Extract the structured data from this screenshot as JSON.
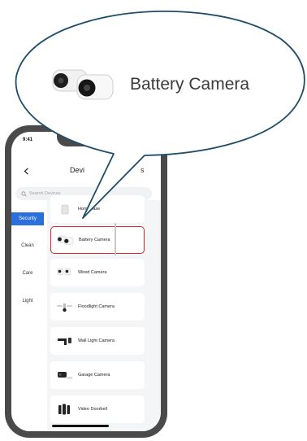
{
  "status_bar": {
    "time": "9:41"
  },
  "nav": {
    "title": "Devi",
    "right_text": "s"
  },
  "search": {
    "placeholder": "Search Devices"
  },
  "sidebar": {
    "items": [
      {
        "label": "Security",
        "active": true
      },
      {
        "label": "Clean",
        "active": false
      },
      {
        "label": "Care",
        "active": false
      },
      {
        "label": "Light",
        "active": false
      }
    ]
  },
  "devices": [
    {
      "label": "HomeBase",
      "icon": "homebase-icon"
    },
    {
      "label": "Battery Camera",
      "icon": "battery-camera-icon",
      "selected": true
    },
    {
      "label": "Wired Camera",
      "icon": "wired-camera-icon"
    },
    {
      "label": "Floodlight Camera",
      "icon": "floodlight-camera-icon"
    },
    {
      "label": "Wall Light Camera",
      "icon": "wall-light-camera-icon"
    },
    {
      "label": "Garage Camera",
      "icon": "garage-camera-icon"
    },
    {
      "label": "Video Doorbell",
      "icon": "video-doorbell-icon"
    }
  ],
  "callout": {
    "label": "Battery Camera",
    "icon": "battery-camera-icon"
  },
  "colors": {
    "accent": "#2a6fdc",
    "highlight": "#d9272e",
    "callout_border": "#1f4e6b"
  }
}
